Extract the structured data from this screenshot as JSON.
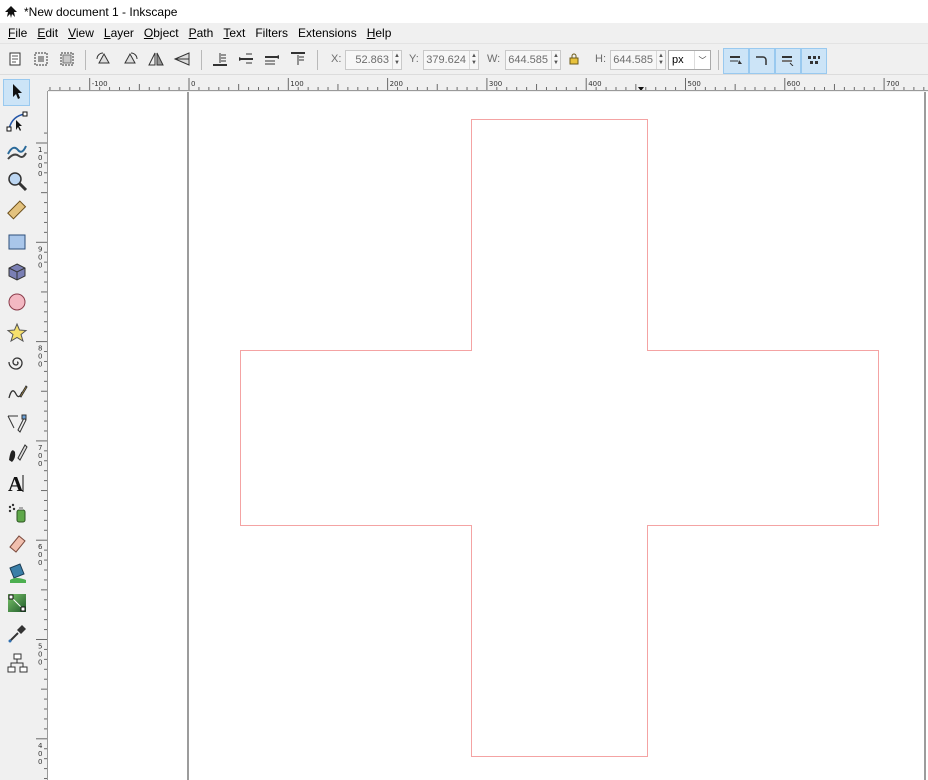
{
  "window": {
    "title": "*New document 1 - Inkscape"
  },
  "menu": [
    {
      "label": "File",
      "mnemonic": "F",
      "rest": "ile"
    },
    {
      "label": "Edit",
      "mnemonic": "E",
      "rest": "dit"
    },
    {
      "label": "View",
      "mnemonic": "V",
      "rest": "iew"
    },
    {
      "label": "Layer",
      "mnemonic": "L",
      "rest": "ayer"
    },
    {
      "label": "Object",
      "mnemonic": "O",
      "rest": "bject"
    },
    {
      "label": "Path",
      "mnemonic": "P",
      "rest": "ath"
    },
    {
      "label": "Text",
      "mnemonic": "T",
      "rest": "ext"
    },
    {
      "label": "Filters",
      "mnemonic": "",
      "rest": "Filters"
    },
    {
      "label": "Extensions",
      "mnemonic": "",
      "rest": "Extensions"
    },
    {
      "label": "Help",
      "mnemonic": "H",
      "rest": "elp"
    }
  ],
  "toolbar": {
    "x_label": "X:",
    "x_value": "52.863",
    "y_label": "Y:",
    "y_value": "379.624",
    "w_label": "W:",
    "w_value": "644.585",
    "h_label": "H:",
    "h_value": "644.585",
    "unit": "px",
    "lock_icon": "lock-icon"
  },
  "tools": [
    {
      "name": "selector-tool",
      "icon": "arrow-select-icon",
      "active": true
    },
    {
      "name": "node-tool",
      "icon": "node-edit-icon",
      "active": false
    },
    {
      "name": "tweak-tool",
      "icon": "tweak-icon",
      "active": false
    },
    {
      "name": "zoom-tool",
      "icon": "magnifier-icon",
      "active": false
    },
    {
      "name": "measure-tool",
      "icon": "ruler-icon",
      "active": false
    },
    {
      "name": "rect-tool",
      "icon": "rectangle-icon",
      "active": false
    },
    {
      "name": "3dbox-tool",
      "icon": "cube-icon",
      "active": false
    },
    {
      "name": "ellipse-tool",
      "icon": "circle-icon",
      "active": false
    },
    {
      "name": "star-tool",
      "icon": "star-icon",
      "active": false
    },
    {
      "name": "spiral-tool",
      "icon": "spiral-icon",
      "active": false
    },
    {
      "name": "pencil-tool",
      "icon": "pencil-icon",
      "active": false
    },
    {
      "name": "pen-tool",
      "icon": "pen-icon",
      "active": false
    },
    {
      "name": "calligraphy-tool",
      "icon": "calligraphy-icon",
      "active": false
    },
    {
      "name": "text-tool",
      "icon": "text-a-icon",
      "active": false
    },
    {
      "name": "spray-tool",
      "icon": "spray-icon",
      "active": false
    },
    {
      "name": "eraser-tool",
      "icon": "eraser-icon",
      "active": false
    },
    {
      "name": "paint-bucket-tool",
      "icon": "bucket-icon",
      "active": false
    },
    {
      "name": "gradient-tool",
      "icon": "gradient-icon",
      "active": false
    },
    {
      "name": "dropper-tool",
      "icon": "dropper-icon",
      "active": false
    },
    {
      "name": "connector-tool",
      "icon": "connector-icon",
      "active": false
    }
  ],
  "hruler": {
    "labels": [
      "-100",
      "0",
      "100",
      "200",
      "300",
      "400",
      "500",
      "600",
      "700"
    ]
  },
  "vruler": {
    "labels": [
      "1000",
      "900",
      "800",
      "700",
      "600",
      "500",
      "400"
    ]
  },
  "canvas": {
    "shape": "cross",
    "stroke_color": "#f4a3a3",
    "page_border_color": "#000000",
    "background": "#ffffff"
  }
}
